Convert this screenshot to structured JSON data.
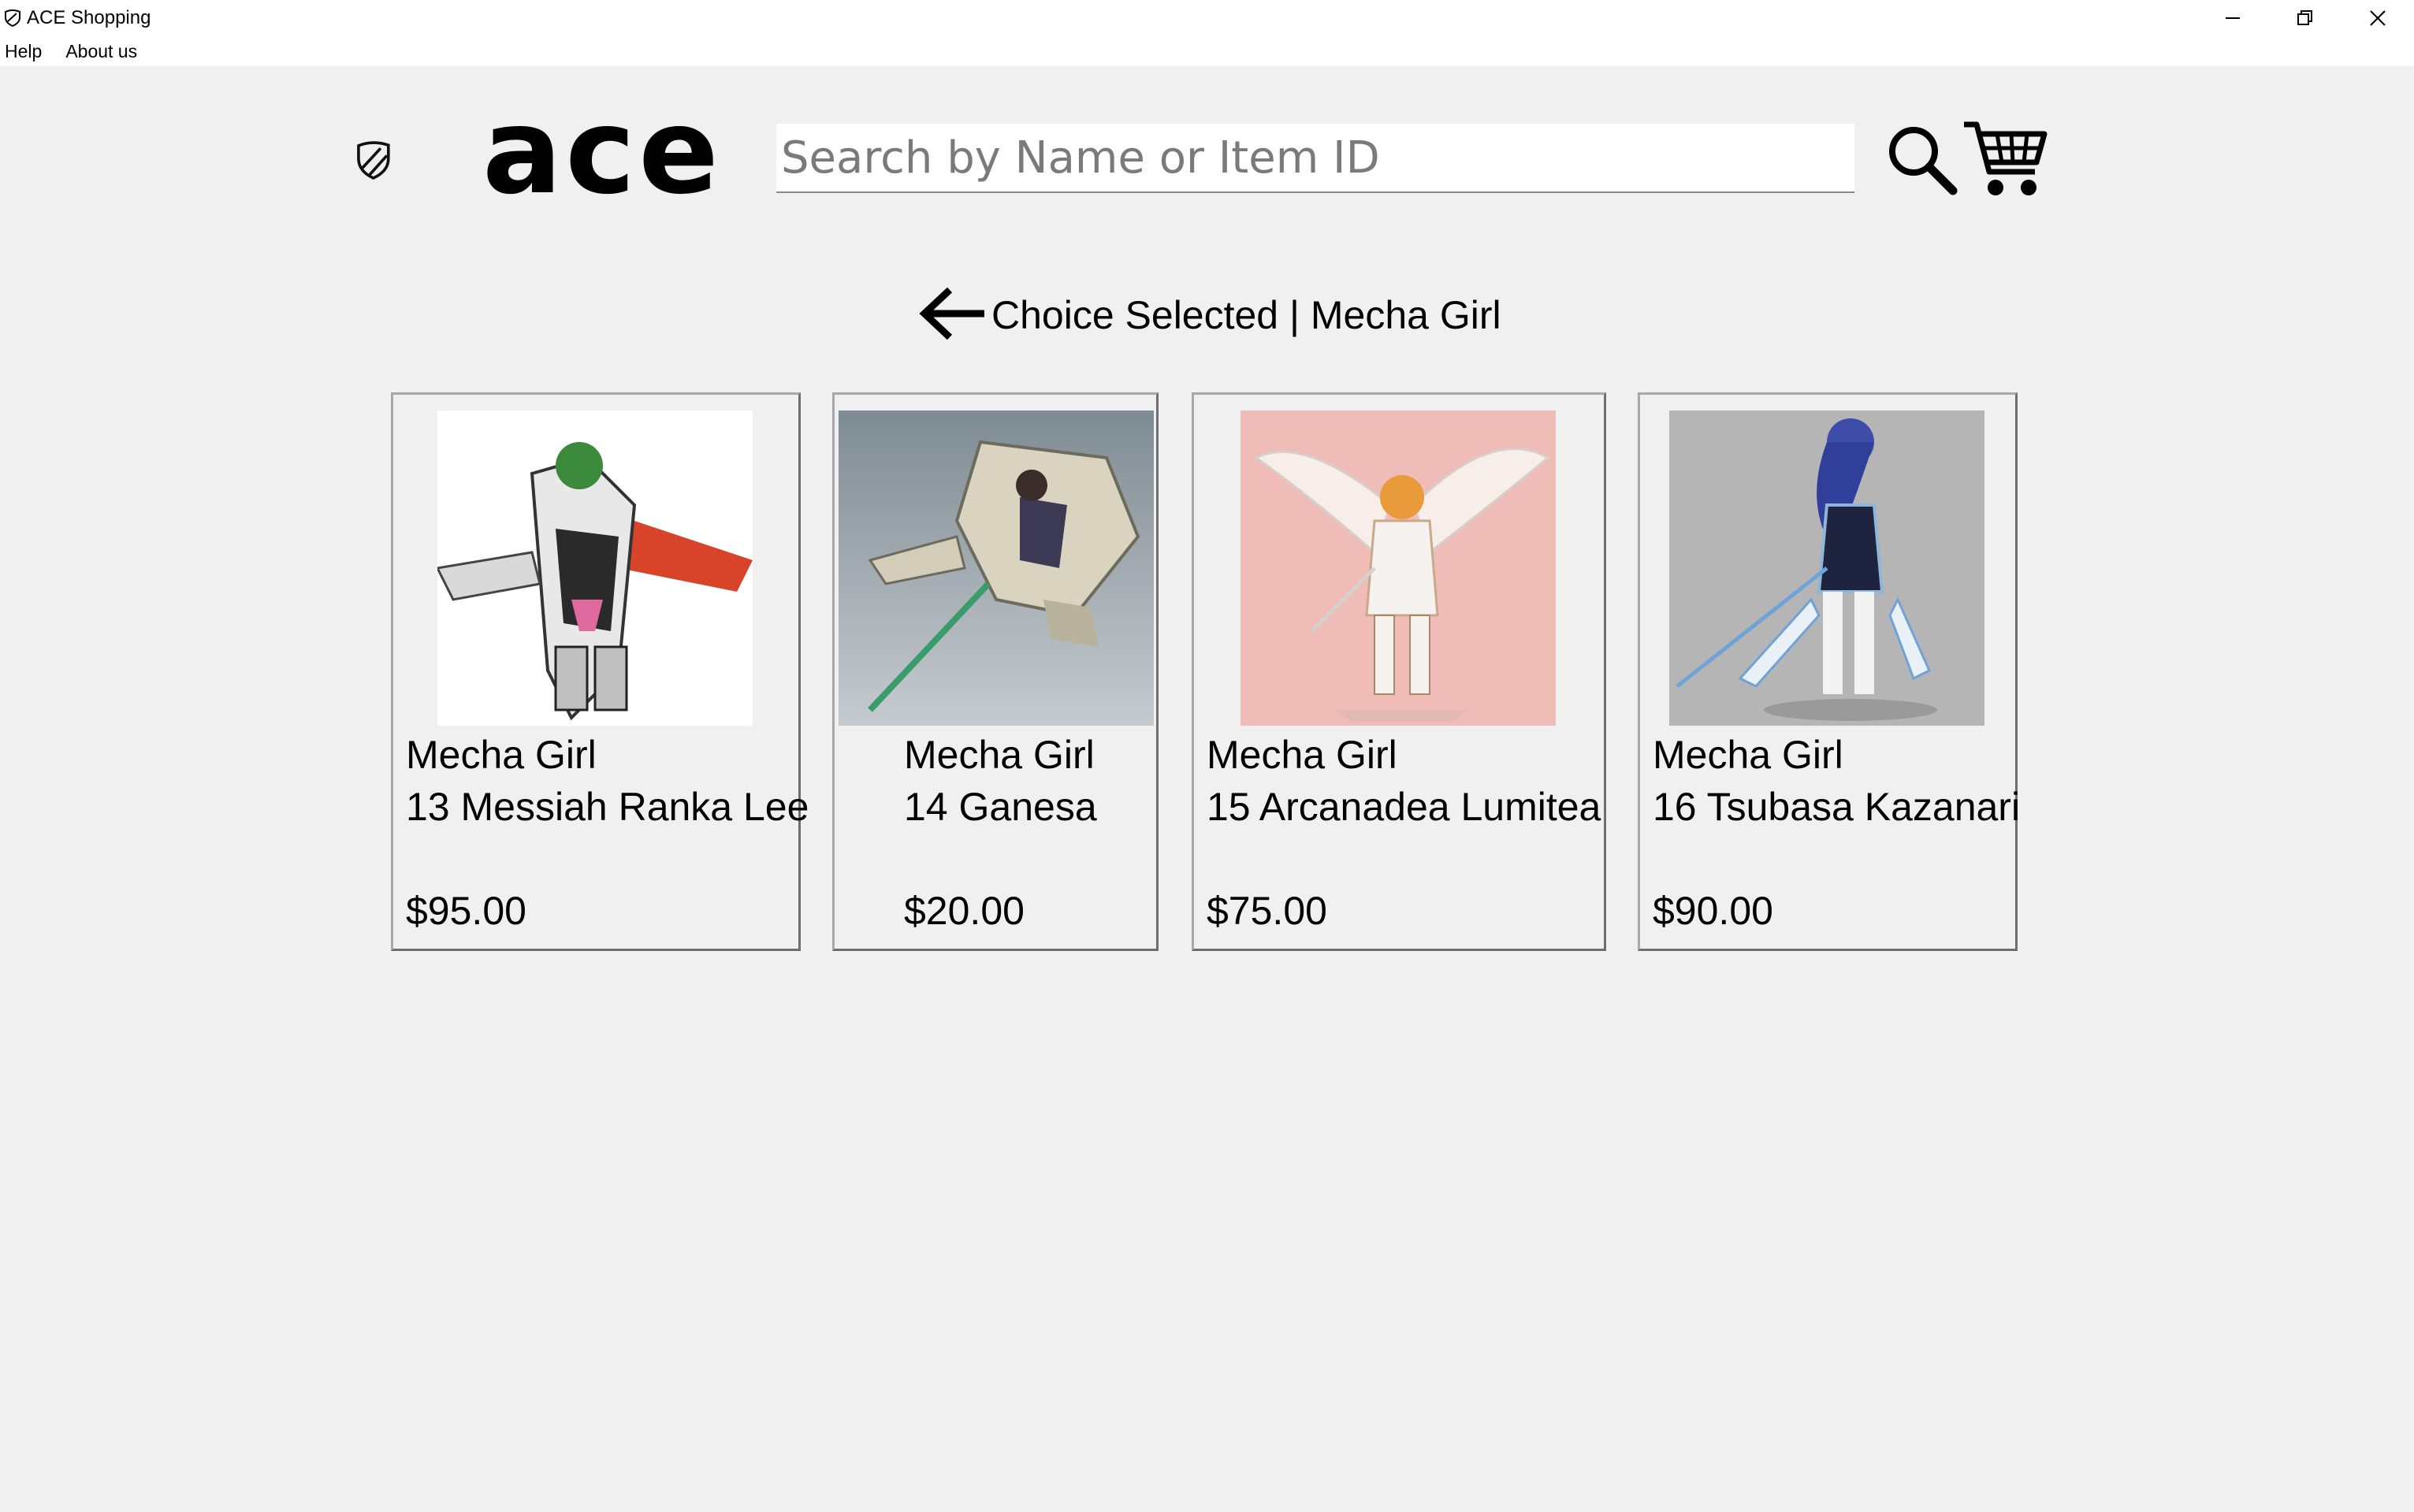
{
  "window": {
    "title": "ACE Shopping",
    "controls": [
      "minimize",
      "restore",
      "close"
    ]
  },
  "menu": {
    "items": [
      "Help",
      "About us"
    ]
  },
  "header": {
    "logo_text": "ace",
    "search_placeholder": "Search by Name or Item ID",
    "search_value": ""
  },
  "selection": {
    "heading": "Choice Selected | Mecha Girl"
  },
  "products": [
    {
      "category": "Mecha Girl",
      "name": "13 Messiah Ranka Lee",
      "price": "$95.00",
      "image_bg": "#ffffff"
    },
    {
      "category": "Mecha Girl",
      "name": "14 Ganesa",
      "price": "$20.00",
      "image_bg": "#a9b2b8"
    },
    {
      "category": "Mecha Girl",
      "name": "15 Arcanadea Lumitea",
      "price": "$75.00",
      "image_bg": "#efbcb8"
    },
    {
      "category": "Mecha Girl",
      "name": "16 Tsubasa Kazanari",
      "price": "$90.00",
      "image_bg": "#b7b7b7"
    }
  ]
}
